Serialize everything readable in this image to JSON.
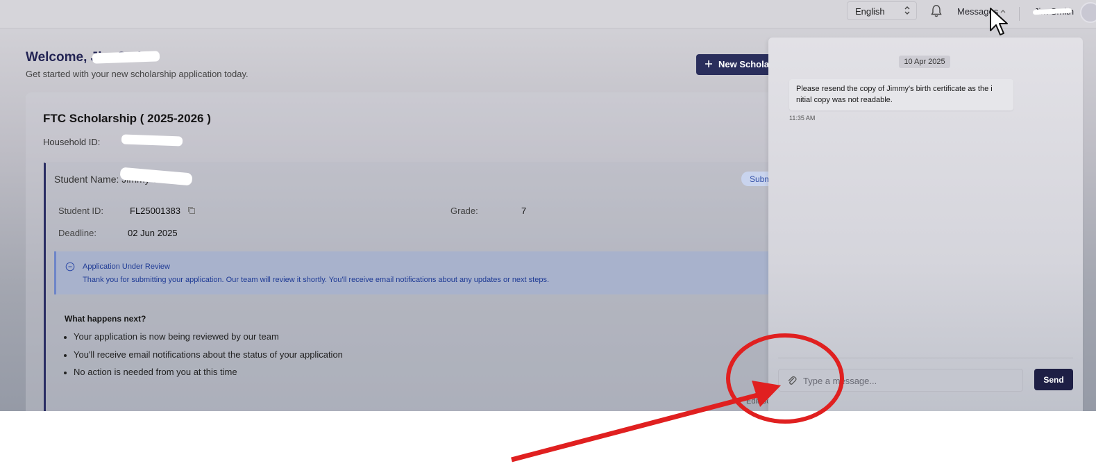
{
  "topbar": {
    "language": "English",
    "messages_label": "Messages",
    "user_name": "Jim Smith"
  },
  "welcome": {
    "title": "Welcome, Jim Smith",
    "subtitle": "Get started with your new scholarship application today."
  },
  "actions": {
    "new_scholarship_label": "New Scholarship"
  },
  "scholarship": {
    "title": "FTC Scholarship ( 2025-2026 )",
    "household_label": "Household ID:",
    "student_name_label": "Student Name: Jimmy Smith",
    "status": "Submitted",
    "student_id_label": "Student ID:",
    "student_id_value": "FL25001383",
    "grade_label": "Grade:",
    "grade_value": "7",
    "deadline_label": "Deadline:",
    "deadline_value": "02 Jun 2025",
    "alert_title": "Application Under Review",
    "alert_body": "Thank you for submitting your application. Our team will review it shortly. You'll receive email notifications about any updates or next steps.",
    "next_title": "What happens next?",
    "next_items": [
      "Your application is now being reviewed by our team",
      "You'll receive email notifications about the status of your application",
      "No action is needed from you at this time"
    ],
    "hidden_link": "Edit Scholarship"
  },
  "messages_panel": {
    "date": "10 Apr 2025",
    "message_line1": "Please resend the copy of Jimmy's birth certificate as the i",
    "message_line2": "nitial copy was not readable.",
    "time": "11:35 AM",
    "input_placeholder": "Type a message...",
    "send_label": "Send"
  },
  "icons": {
    "bell": "bell-icon",
    "chevron_up": "chevron-up-icon",
    "copy": "copy-icon",
    "info": "info-icon",
    "paperclip": "paperclip-icon",
    "plus": "plus-icon",
    "cursor": "mouse-cursor-icon"
  },
  "colors": {
    "primary_navy": "#2a2e5c",
    "alert_blue": "#1f3b95",
    "annotation_red": "#e02020"
  }
}
